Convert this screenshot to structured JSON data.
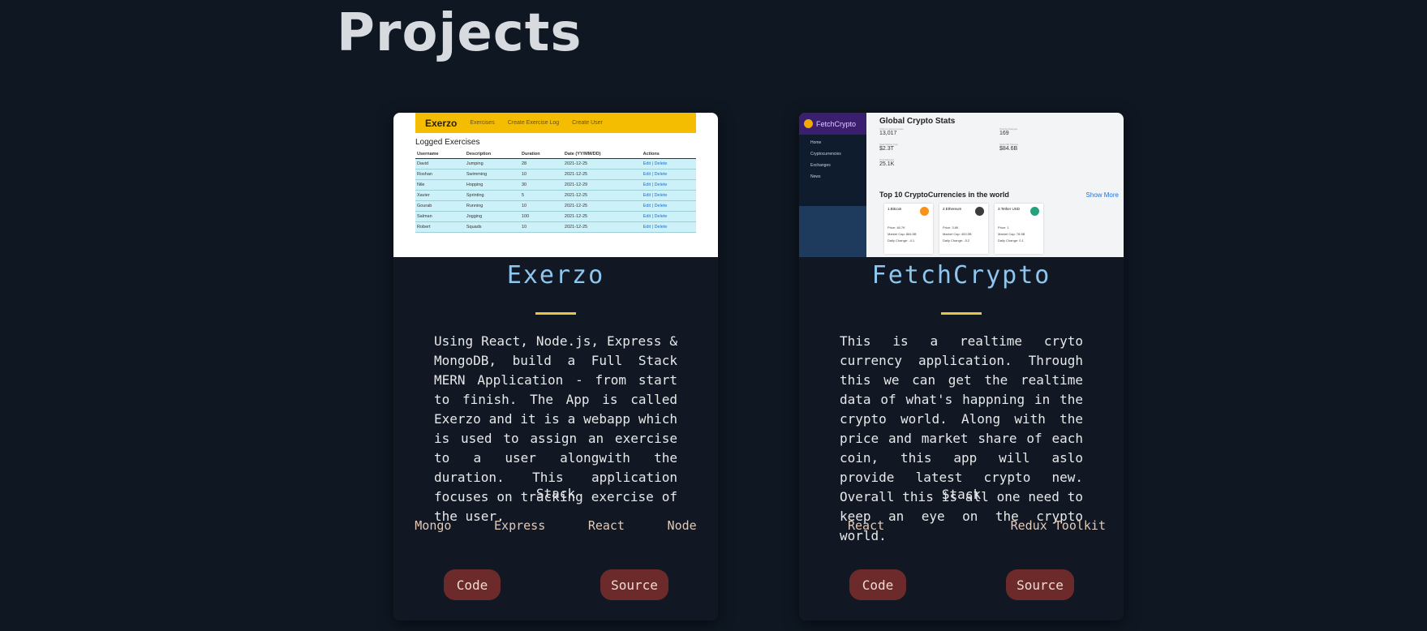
{
  "section_title": "Projects",
  "projects": [
    {
      "title": "Exerzo",
      "description": "Using React, Node.js, Express & MongoDB, build a Full Stack MERN Application - from start to finish. The App is called Exerzo and it is a webapp which is used to assign an exercise to a user alongwith the duration. This application focuses on tracking exercise of the user.",
      "stack_label": "Stack",
      "stack": [
        "Mongo",
        "Express",
        "React",
        "Node"
      ],
      "code_label": "Code",
      "source_label": "Source",
      "thumbnail": {
        "brand": "Exerzo",
        "nav": [
          "Exercises",
          "Create Exercise Log",
          "Create User"
        ],
        "heading": "Logged Exercises",
        "columns": [
          "Username",
          "Description",
          "Duration",
          "Date (YY/MM/DD)",
          "Actions"
        ],
        "rows": [
          [
            "David",
            "Jumping",
            "28",
            "2021-12-25",
            "Edit | Delete"
          ],
          [
            "Roshan",
            "Swimming",
            "10",
            "2021-12-25",
            "Edit | Delete"
          ],
          [
            "Nile",
            "Hopping",
            "30",
            "2021-12-29",
            "Edit | Delete"
          ],
          [
            "Xavier",
            "Sprinting",
            "5",
            "2021-12-25",
            "Edit | Delete"
          ],
          [
            "Gourab",
            "Running",
            "10",
            "2021-12-25",
            "Edit | Delete"
          ],
          [
            "Salman",
            "Jogging",
            "100",
            "2021-12-25",
            "Edit | Delete"
          ],
          [
            "Robert",
            "Squads",
            "10",
            "2021-12-25",
            "Edit | Delete"
          ]
        ]
      }
    },
    {
      "title": "FetchCrypto",
      "description": "This is a realtime cryto currency application. Through this we can get the realtime data of what's happning in the crypto world. Along with the price and market share of each coin, this app will aslo provide latest crypto new. Overall this is all one need to keep an eye on the crypto world.",
      "stack_label": "Stack",
      "stack": [
        "React",
        "Redux Toolkit"
      ],
      "code_label": "Code",
      "source_label": "Source",
      "thumbnail": {
        "brand": "FetchCrypto",
        "menu": [
          "Home",
          "Cryptocurrencies",
          "Exchanges",
          "News"
        ],
        "heading": "Global Crypto Stats",
        "stats": [
          {
            "label": "Total Cryptocurrencies",
            "value": "13,017"
          },
          {
            "label": "Total Exchanges",
            "value": "169"
          },
          {
            "label": "Total Market Cap",
            "value": "$2.3T"
          },
          {
            "label": "Total 24h Volume",
            "value": "$84.6B"
          },
          {
            "label": "Total Markets",
            "value": "25.1K"
          }
        ],
        "subheading": "Top 10 CryptoCurrencies in the world",
        "show_more": "Show More",
        "coins": [
          {
            "name": "1.Bitcoin",
            "price": "Price: 46.7K",
            "cap": "Market Cap: 884.5B",
            "change": "Daily Change: -4.1",
            "color": "#f7931a"
          },
          {
            "name": "2.Ethereum",
            "price": "Price: 3.8K",
            "cap": "Market Cap: 453.5B",
            "change": "Daily Change: -5.2",
            "color": "#3c3c3d"
          },
          {
            "name": "3.Tether USD",
            "price": "Price: 1",
            "cap": "Market Cap: 78.5B",
            "change": "Daily Change: 0.1",
            "color": "#26a17b"
          }
        ]
      }
    }
  ]
}
